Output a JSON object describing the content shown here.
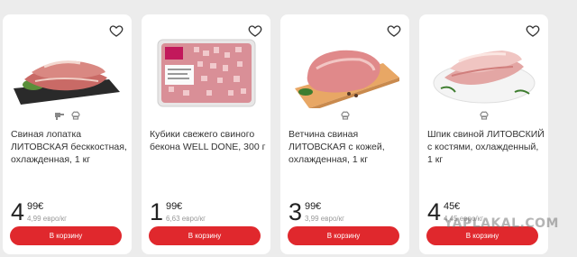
{
  "products": [
    {
      "title": "Свиная лопатка ЛИТОВСКАЯ бесккостная, охлажденная, 1 кг",
      "price_whole": "4",
      "price_frac": "99",
      "currency": "€",
      "unit_price": "4,99 евро/кг",
      "button": "В корзину",
      "tags": [
        "meat-grinder-icon",
        "chef-hat-icon"
      ]
    },
    {
      "title": "Кубики свежего свиного бекона WELL DONE, 300 г",
      "price_whole": "1",
      "price_frac": "99",
      "currency": "€",
      "unit_price": "6,63 евро/кг",
      "button": "В корзину",
      "tags": [],
      "package_brand": "Well Done"
    },
    {
      "title": "Ветчина свиная ЛИТОВСКАЯ с кожей, охлажденная, 1 кг",
      "price_whole": "3",
      "price_frac": "99",
      "currency": "€",
      "unit_price": "3,99 евро/кг",
      "button": "В корзину",
      "tags": [
        "chef-hat-icon"
      ]
    },
    {
      "title": "Шпик свиной ЛИТОВСКИЙ с костями, охлажденный, 1 кг",
      "price_whole": "4",
      "price_frac": "45",
      "currency": "€",
      "unit_price": "4,45 евро/кг",
      "button": "В корзину",
      "tags": [
        "chef-hat-icon"
      ]
    }
  ],
  "watermark": "YAPLAKAL.COM",
  "colors": {
    "accent": "#e0282d",
    "background": "#ececec",
    "card": "#ffffff"
  }
}
